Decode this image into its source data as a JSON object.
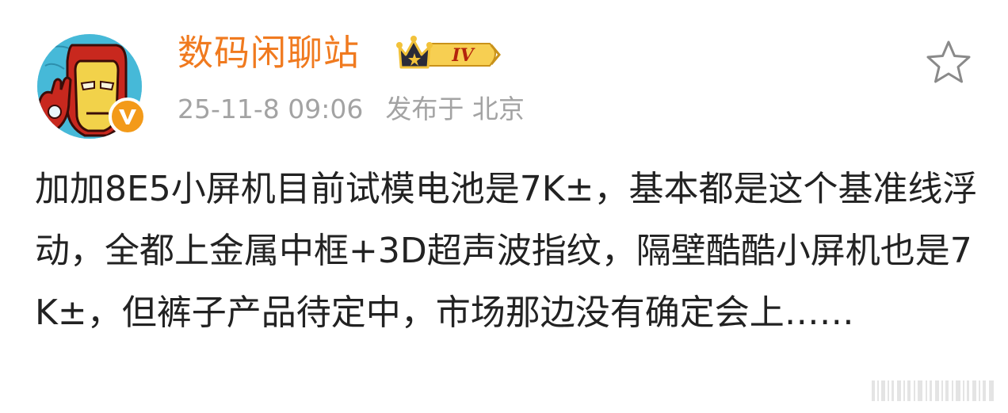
{
  "colors": {
    "username": "#f07a1f",
    "meta": "#a3a3a3",
    "body_text": "#222222",
    "verified_badge": "#f39a19",
    "avatar_bg": "#44b8d6"
  },
  "post": {
    "author": {
      "name": "数码闲聊站",
      "avatar_icon": "iron-man-avatar",
      "verified_icon": "verified-v-icon",
      "level_badge": {
        "icon": "crown-icon",
        "text": "IV"
      }
    },
    "meta": {
      "timestamp": "25-11-8 09:06",
      "location": "发布于 北京"
    },
    "favorite_icon": "star-outline-icon",
    "body": "加加8E5小屏机目前试模电池是7K±，基本都是这个基准线浮动，全都上金属中框+3D超声波指纹，隔壁酷酷小屏机也是7K±，但裤子产品待定中，市场那边没有确定会上……",
    "watermark_icon": "barcode-watermark"
  }
}
